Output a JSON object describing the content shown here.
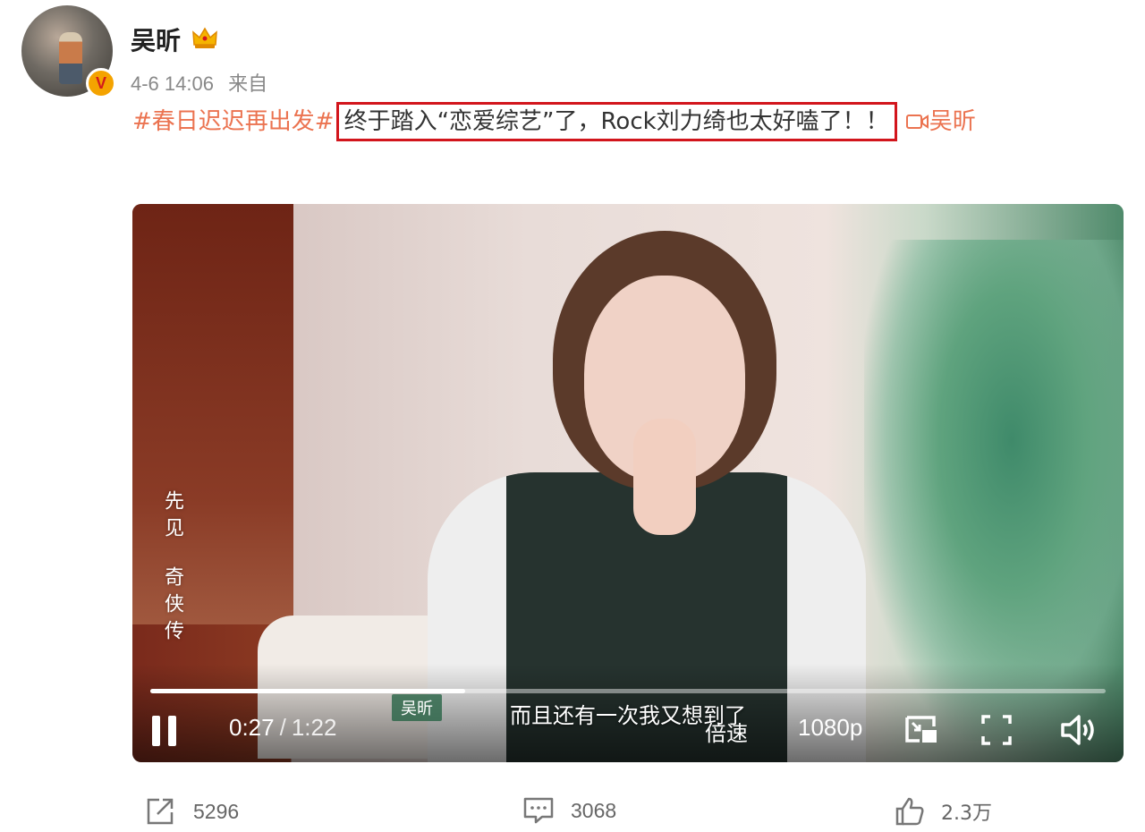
{
  "post": {
    "author": "吴昕",
    "time": "4-6 14:06",
    "source_prefix": "来自",
    "hashtag": "#春日迟迟再出发#",
    "highlighted_text": "终于踏入“恋爱综艺”了，Rock刘力绮也太好嗑了！！",
    "mention": "吴昕",
    "verified_badge": "V"
  },
  "video": {
    "overlay_logo_line1": "先见",
    "overlay_logo_line2": "奇侠传",
    "subtitle_name": "吴昕",
    "subtitle": "而且还有一次我又想到了",
    "current_time": "0:27",
    "time_separator": "/",
    "duration": "1:22",
    "progress": 0.33,
    "speed_label": "倍速",
    "quality_label": "1080p"
  },
  "actions": {
    "forward_count": "5296",
    "comment_count": "3068",
    "like_count": "2.3万"
  },
  "colors": {
    "hashtag": "#eb7350",
    "highlight_border": "#d2151c",
    "badge": "#f4a300"
  }
}
